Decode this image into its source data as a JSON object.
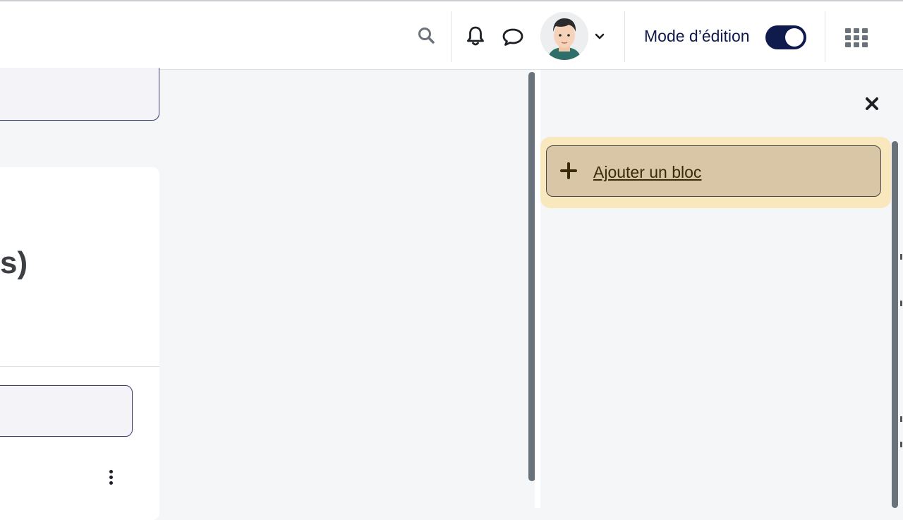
{
  "navbar": {
    "search_icon": "search-icon",
    "notifications_icon": "bell-icon",
    "messages_icon": "chat-bubble-icon",
    "user_menu_icon": "chevron-down-icon",
    "edit_mode_label": "Mode d’édition",
    "edit_mode_on": true,
    "apps_icon": "grid-icon"
  },
  "main": {
    "card_title_partial": "s)"
  },
  "drawer": {
    "close_icon": "close-icon",
    "add_block_label": "Ajouter un bloc",
    "add_block_icon": "plus-icon"
  },
  "colors": {
    "primary": "#0f1a4d",
    "add_block_highlight": "#f9e7bd",
    "add_block_bg": "#d9c6a6",
    "page_bg": "#f5f6f8"
  }
}
